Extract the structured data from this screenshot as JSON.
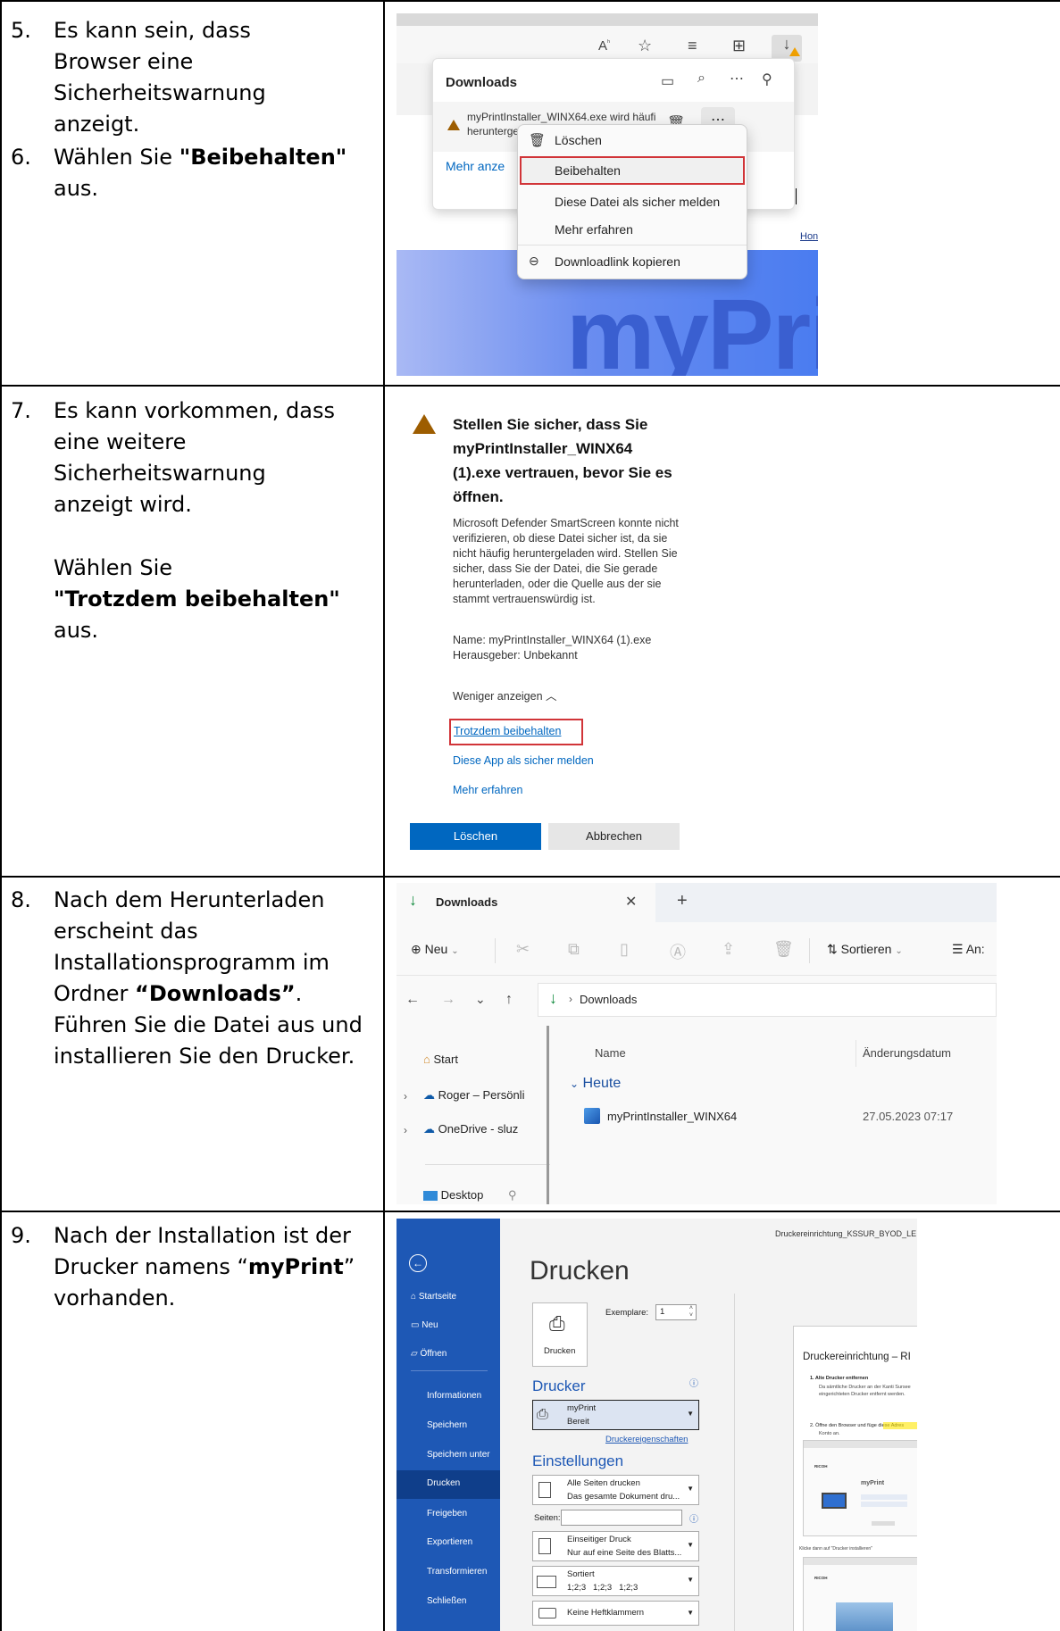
{
  "steps": [
    {
      "num": "5.",
      "line1": "Es kann sein, dass Browser eine Sicherheitswarnung anzeigt.",
      "num2": "6.",
      "pre": "Wählen Sie ",
      "bold": "\"Beibehalten\"",
      "post": " aus."
    },
    {
      "num": "7.",
      "line1": "Es kann vorkommen, dass eine weitere Sicherheitswarnung anzeigt wird.",
      "pre": "Wählen Sie ",
      "bold": "\"Trotzdem beibehalten\"",
      "post": " aus."
    },
    {
      "num": "8.",
      "pre": "Nach dem Herunterladen erscheint das Installationsprogramm im Ordner ",
      "bold": "“Downloads”",
      "post": ". Führen Sie die Datei aus und installieren Sie den Drucker."
    },
    {
      "num": "9.",
      "pre": "Nach der Installation ist der Drucker namens “",
      "bold": "myPrint",
      "post": "” vorhanden."
    }
  ],
  "shot1": {
    "toolbar_icons": [
      "Aᴬ",
      "☆",
      "≡",
      "⊞",
      "↓"
    ],
    "panel_title": "Downloads",
    "file_line1": "myPrintInstaller_WINX64.exe wird häufi",
    "file_line2": "heruntergeladen. Stellen Sie sicher, das:",
    "more_link": "Mehr anze",
    "menu": [
      "Löschen",
      "Beibehalten",
      "Diese Datei als sicher melden",
      "Mehr erfahren",
      "Downloadlink kopieren"
    ],
    "bg_text": "myPrint",
    "side_link": "Hon"
  },
  "shot2": {
    "title": "Stellen Sie sicher, dass Sie myPrintInstaller_WINX64 (1).exe vertrauen, bevor Sie es öffnen.",
    "body": "Microsoft Defender SmartScreen konnte nicht verifizieren, ob diese Datei sicher ist, da sie nicht häufig heruntergeladen wird. Stellen Sie sicher, dass Sie der Datei, die Sie gerade herunterladen, oder die Quelle aus der sie stammt vertrauenswürdig ist.",
    "name_line": "Name: myPrintInstaller_WINX64 (1).exe",
    "publisher_line": "Herausgeber: Unbekannt",
    "less": "Weniger anzeigen",
    "keep_anyway": "Trotzdem beibehalten",
    "report_safe": "Diese App als sicher melden",
    "learn_more": "Mehr erfahren",
    "delete": "Löschen",
    "cancel": "Abbrechen"
  },
  "shot3": {
    "tab_title": "Downloads",
    "new": "Neu",
    "sort": "Sortieren",
    "view": "An:",
    "breadcrumb": "Downloads",
    "nav": [
      "Start",
      "Roger – Persönli",
      "OneDrive - sluz",
      "Desktop"
    ],
    "col_name": "Name",
    "col_date": "Änderungsdatum",
    "group": "Heute",
    "file_name": "myPrintInstaller_WINX64",
    "file_date": "27.05.2023 07:17"
  },
  "shot4": {
    "doc_title": "Druckereinrichtung_KSSUR_BYOD_LE",
    "nav": [
      "Startseite",
      "Neu",
      "Öffnen",
      "Informationen",
      "Speichern",
      "Speichern unter",
      "Drucken",
      "Freigeben",
      "Exportieren",
      "Transformieren",
      "Schließen"
    ],
    "heading": "Drucken",
    "copies_label": "Exemplare:",
    "copies_value": "1",
    "print_btn": "Drucken",
    "printer_heading": "Drucker",
    "printer_name": "myPrint",
    "printer_status": "Bereit",
    "printer_props": "Druckereigenschaften",
    "settings_heading": "Einstellungen",
    "opt1_a": "Alle Seiten drucken",
    "opt1_b": "Das gesamte Dokument dru...",
    "pages_label": "Seiten:",
    "opt2_a": "Einseitiger Druck",
    "opt2_b": "Nur auf eine Seite des Blatts...",
    "opt3_a": "Sortiert",
    "opt3_b": "1;2;3   1;2;3   1;2;3",
    "opt4_a": "Keine Heftklammern",
    "preview_title": "Druckereinrichtung – RI",
    "preview_item1": "1.  Alte Drucker entfernen",
    "preview_text1": "Da sämtliche Drucker an der Kanti Sursee",
    "preview_text2": "eingerichteten  Drucker entfernt werden.",
    "preview_item2": "2.  Öffne den Browser und füge diese Adres",
    "preview_text3": "Konto an.",
    "preview_brand": "myPrint",
    "preview_caption": "Klicke dann auf \"Drucker installieren\"",
    "preview_logo": "RICOH"
  },
  "colors": {
    "accent_blue": "#0067c0",
    "word_blue": "#185abd",
    "red_highlight": "#d13438",
    "warn": "#9d5d00"
  }
}
